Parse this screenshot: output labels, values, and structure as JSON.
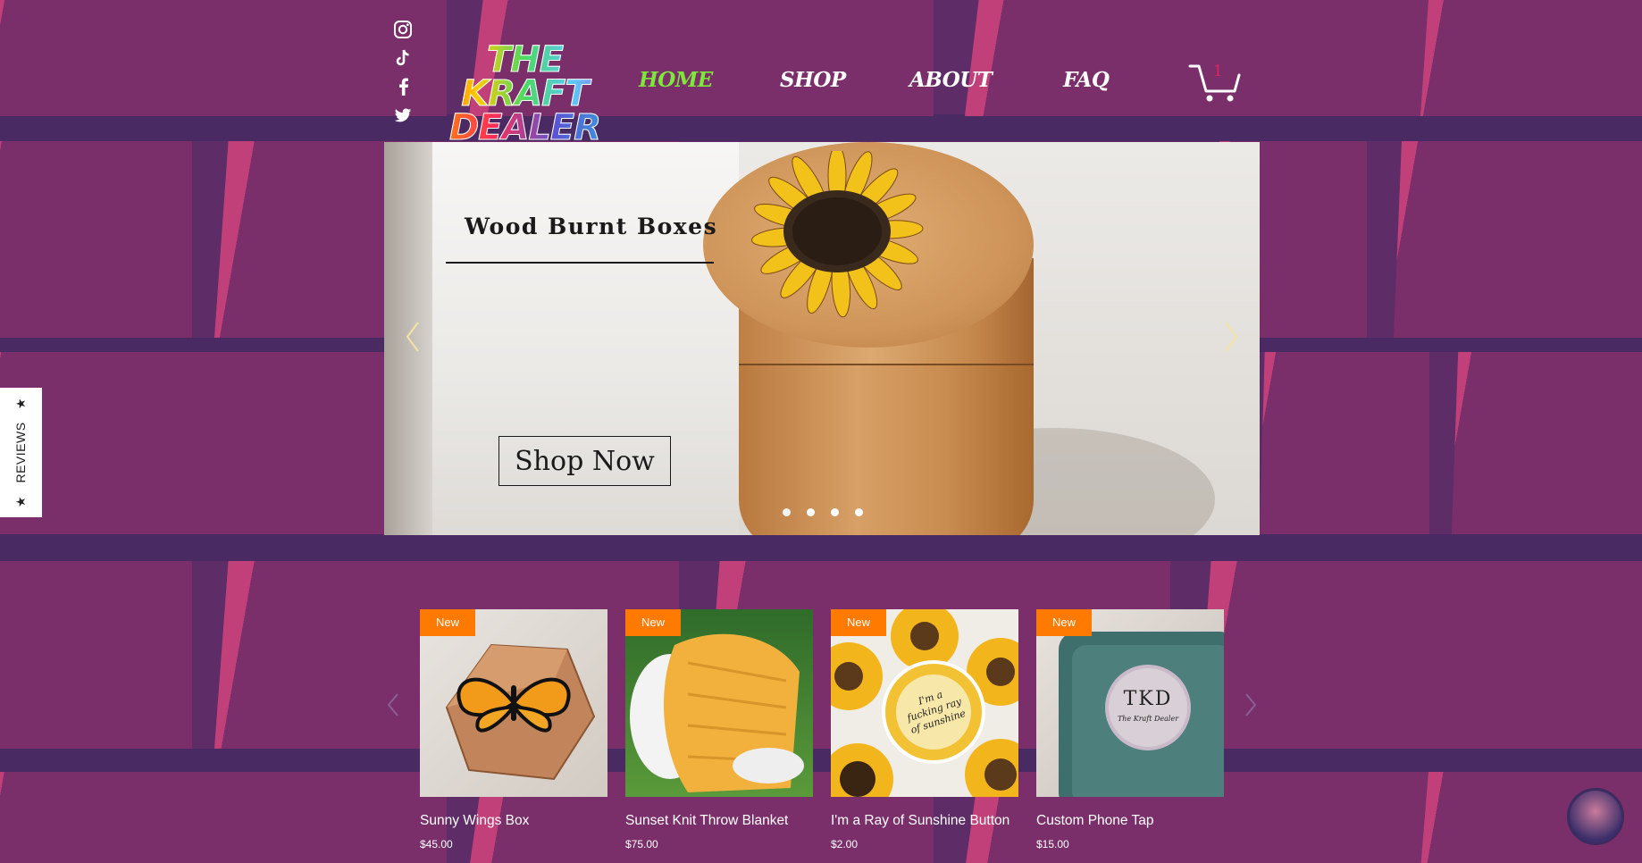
{
  "brand": {
    "logo_line1": "THE KRAFT",
    "logo_line2": "DEALER"
  },
  "social": [
    "instagram-icon",
    "tiktok-icon",
    "facebook-icon",
    "twitter-icon"
  ],
  "nav": [
    {
      "label": "HOME",
      "active": true
    },
    {
      "label": "SHOP",
      "active": false
    },
    {
      "label": "ABOUT",
      "active": false
    },
    {
      "label": "FAQ",
      "active": false
    }
  ],
  "cart": {
    "count": "1"
  },
  "hero": {
    "title": "Wood Burnt Boxes",
    "cta": "Shop Now",
    "slide_count": 4,
    "active_slide": 1,
    "prev_icon": "chevron-left-icon",
    "next_icon": "chevron-right-icon"
  },
  "reviews_tab": {
    "label": "REVIEWS"
  },
  "products": [
    {
      "badge": "New",
      "name": "Sunny Wings Box",
      "price": "$45.00"
    },
    {
      "badge": "New",
      "name": "Sunset Knit Throw Blanket",
      "price": "$75.00"
    },
    {
      "badge": "New",
      "name": "I'm a Ray of Sunshine Button",
      "price": "$2.00"
    },
    {
      "badge": "New",
      "name": "Custom Phone Tap",
      "price": "$15.00"
    }
  ],
  "button_texts": {
    "img3": "I'm a fucking ray of sunshine",
    "img4_big": "TKD",
    "img4_small": "The Kraft Dealer"
  },
  "colors": {
    "background": "#5e2d68",
    "nav_active": "#7ee83a",
    "badge": "#ff7a00",
    "cart_count": "#e0245e"
  }
}
